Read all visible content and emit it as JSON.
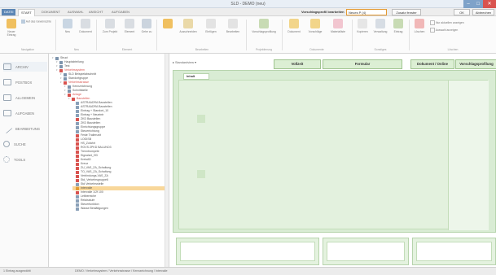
{
  "window": {
    "title": "SLD - DEMO (neu)"
  },
  "tabs": [
    {
      "label": "DATEI"
    },
    {
      "label": "START"
    },
    {
      "label": "DOKUMENT"
    },
    {
      "label": "AUSWAHL"
    },
    {
      "label": "ANSICHT"
    },
    {
      "label": "AUFGABEN"
    }
  ],
  "toolbar_right": {
    "label": "Vorschlagsprofil bearbeiten",
    "value": "Neues P (4)",
    "zusatz_button": "Zusatz fenster",
    "ok_button": "OK",
    "cancel_button": "Abbrechen"
  },
  "ribbon": {
    "groups": [
      {
        "label": "Navigation"
      },
      {
        "label": "Neu"
      },
      {
        "label": "Element"
      },
      {
        "label": "Bearbeiten"
      },
      {
        "label": "Projektierung"
      },
      {
        "label": "Dokumente"
      },
      {
        "label": "Sonstiges"
      },
      {
        "label": "Löschen"
      }
    ],
    "buttons": [
      {
        "label": "Neuer Eintrag"
      },
      {
        "label": "Auf das Gewünschte"
      },
      {
        "label": "Neu"
      },
      {
        "label": "Dokument"
      },
      {
        "label": "Zum Projekt"
      },
      {
        "label": "Element"
      },
      {
        "label": "Gehe zu"
      },
      {
        "label": "Ausschneiden"
      },
      {
        "label": "Einfügen"
      },
      {
        "label": "Bearbeiten"
      },
      {
        "label": "Vorschlagsprofilung"
      },
      {
        "label": "Dokument"
      },
      {
        "label": "Vorschläge"
      },
      {
        "label": "Materialliste"
      },
      {
        "label": "Kopieren"
      },
      {
        "label": "Verwaltung"
      },
      {
        "label": "Eintrag"
      },
      {
        "label": "Löschen"
      }
    ],
    "right_options": [
      {
        "label": "Nur aktuellen anzeigen"
      },
      {
        "label": "Auswahl anzeigen"
      }
    ]
  },
  "leftnav": [
    {
      "label": "ARCHIV",
      "icon": "archive-icon"
    },
    {
      "label": "POSTBOX",
      "icon": "mail-icon"
    },
    {
      "label": "ALLGEMEIN",
      "icon": "folder-icon"
    },
    {
      "label": "AUFGABEN",
      "icon": "check-icon"
    },
    {
      "label": "BEARBEITUNG",
      "icon": "pencil-icon"
    },
    {
      "label": "SUCHE",
      "icon": "search-icon"
    },
    {
      "label": "TOOLS",
      "icon": "gear-icon"
    }
  ],
  "tree": [
    {
      "label": "Struct",
      "indent": 0,
      "color": "#7d94ad"
    },
    {
      "label": "Hauptabteilung",
      "indent": 1,
      "color": "#7d94ad"
    },
    {
      "label": "Test",
      "indent": 1,
      "color": "#7d94ad"
    },
    {
      "label": "Verkehrssystem",
      "indent": 1,
      "color": "#d9534f",
      "red": true
    },
    {
      "label": "SLD Beispielabschnitt",
      "indent": 2,
      "color": "#7d94ad"
    },
    {
      "label": "Standortgruppe",
      "indent": 2,
      "color": "#7d94ad"
    },
    {
      "label": "Verkehrsstrasse",
      "indent": 2,
      "color": "#d9534f",
      "red": true
    },
    {
      "label": "Kennzeichnung",
      "indent": 3,
      "color": "#7d94ad"
    },
    {
      "label": "Schnittstelle",
      "indent": 3,
      "color": "#7d94ad"
    },
    {
      "label": "Anlage",
      "indent": 3,
      "color": "#d9534f",
      "red": true
    },
    {
      "label": "Baustellen",
      "indent": 4,
      "color": "#d9534f",
      "red": true
    },
    {
      "label": "ASTRAADRA Baustellen",
      "indent": 5,
      "color": "#8aa0b8"
    },
    {
      "label": "ASTRAADRA Baustellen",
      "indent": 5,
      "color": "#8aa0b8"
    },
    {
      "label": "Eintrag + Standort_10",
      "indent": 5,
      "color": "#8aa0b8"
    },
    {
      "label": "Eintrag + Neueintr",
      "indent": 5,
      "color": "#8aa0b8"
    },
    {
      "label": "ZKD Baustellen",
      "indent": 5,
      "color": "#d9534f"
    },
    {
      "label": "ZKD Baustellen",
      "indent": 5,
      "color": "#8aa0b8"
    },
    {
      "label": "Einrichtungsgruppe",
      "indent": 5,
      "color": "#8aa0b8"
    },
    {
      "label": "Steuerrichtung",
      "indent": 5,
      "color": "#8aa0b8"
    },
    {
      "label": "Feste Trailerunit",
      "indent": 5,
      "color": "#d9534f"
    },
    {
      "label": "LOGISB",
      "indent": 5,
      "color": "#d9534f"
    },
    {
      "label": "HS_Zufahrt",
      "indent": 5,
      "color": "#d9534f"
    },
    {
      "label": "ROVS ZPKD BALUNO3",
      "indent": 5,
      "color": "#d9534f"
    },
    {
      "label": "Trenntrompete",
      "indent": 5,
      "color": "#d9534f"
    },
    {
      "label": "Signalart_OD",
      "indent": 5,
      "color": "#d9534f"
    },
    {
      "label": "KreisAD",
      "indent": 5,
      "color": "#d9534f"
    },
    {
      "label": "Kreuz",
      "indent": 5,
      "color": "#d9534f"
    },
    {
      "label": "ZU_VAS_ZA_Schaltung",
      "indent": 5,
      "color": "#d9534f"
    },
    {
      "label": "TO_VAS_ZA_Schaltung",
      "indent": 5,
      "color": "#d9534f"
    },
    {
      "label": "Verbindungs-VAS_ZA",
      "indent": 5,
      "color": "#d9534f"
    },
    {
      "label": "Std_Verkehrsgruppe6",
      "indent": 5,
      "color": "#d9534f"
    },
    {
      "label": "Std Verkehrsstelle",
      "indent": 5,
      "color": "#8aa0b8"
    },
    {
      "label": "Intervalle",
      "indent": 5,
      "color": "#e49a32",
      "selected": true
    },
    {
      "label": "Intervalle 1/2f 100",
      "indent": 5,
      "color": "#d9534f"
    },
    {
      "label": "Leitbereiche",
      "indent": 5,
      "color": "#8aa0b8"
    },
    {
      "label": "Relaisstufe",
      "indent": 5,
      "color": "#8aa0b8"
    },
    {
      "label": "Steuerfunktion",
      "indent": 5,
      "color": "#8aa0b8"
    },
    {
      "label": "Wasse Bestätigungen",
      "indent": 5,
      "color": "#8aa0b8"
    }
  ],
  "main": {
    "view_label": "Standardview",
    "tabs": [
      {
        "label": "Vollzeit"
      },
      {
        "label": "Formular"
      },
      {
        "label": "Dokument / Online"
      },
      {
        "label": "Vorschlagsprofilung"
      }
    ],
    "inner_tab": "Inhalt"
  },
  "statusbar": {
    "left": "1 Eintrag ausgewählt",
    "path": "DEMO / Verkehrssystem / Verkehrsstrasse / Kennzeichnung / Intervalle"
  }
}
